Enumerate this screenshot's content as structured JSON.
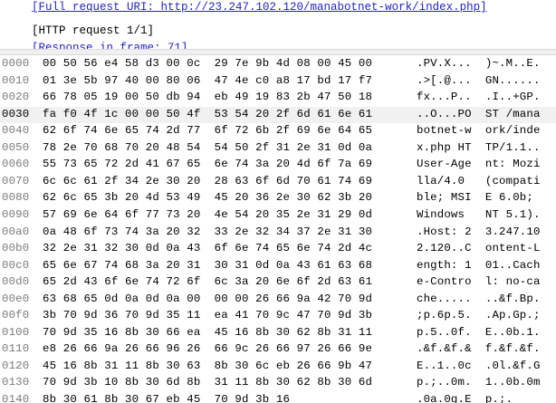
{
  "detail": {
    "lines": [
      {
        "text": "[Full request URI: http://23.247.102.120/manabotnet-work/index.php]",
        "link": true
      },
      {
        "text": "[HTTP request 1/1]",
        "link": false
      },
      {
        "text": "[Response in frame: 71]",
        "link": true
      }
    ]
  },
  "hexdump": {
    "selected_row": 3,
    "rows": [
      {
        "offset": "0000",
        "hex": "00 50 56 e4 58 d3 00 0c  29 7e 9b 4d 08 00 45 00",
        "ascii": ".PV.X...  )~.M..E."
      },
      {
        "offset": "0010",
        "hex": "01 3e 5b 97 40 00 80 06  47 4e c0 a8 17 bd 17 f7",
        "ascii": ".>[.@...  GN......"
      },
      {
        "offset": "0020",
        "hex": "66 78 05 19 00 50 db 94  eb 49 19 83 2b 47 50 18",
        "ascii": "fx...P..  .I..+GP."
      },
      {
        "offset": "0030",
        "hex": "fa f0 4f 1c 00 00 50 4f  53 54 20 2f 6d 61 6e 61",
        "ascii": "..O...PO  ST /mana"
      },
      {
        "offset": "0040",
        "hex": "62 6f 74 6e 65 74 2d 77  6f 72 6b 2f 69 6e 64 65",
        "ascii": "botnet-w  ork/inde"
      },
      {
        "offset": "0050",
        "hex": "78 2e 70 68 70 20 48 54  54 50 2f 31 2e 31 0d 0a",
        "ascii": "x.php HT  TP/1.1.."
      },
      {
        "offset": "0060",
        "hex": "55 73 65 72 2d 41 67 65  6e 74 3a 20 4d 6f 7a 69",
        "ascii": "User-Age  nt: Mozi"
      },
      {
        "offset": "0070",
        "hex": "6c 6c 61 2f 34 2e 30 20  28 63 6f 6d 70 61 74 69",
        "ascii": "lla/4.0   (compati"
      },
      {
        "offset": "0080",
        "hex": "62 6c 65 3b 20 4d 53 49  45 20 36 2e 30 62 3b 20",
        "ascii": "ble; MSI  E 6.0b; "
      },
      {
        "offset": "0090",
        "hex": "57 69 6e 64 6f 77 73 20  4e 54 20 35 2e 31 29 0d",
        "ascii": "Windows   NT 5.1)."
      },
      {
        "offset": "00a0",
        "hex": "0a 48 6f 73 74 3a 20 32  33 2e 32 34 37 2e 31 30",
        "ascii": ".Host: 2  3.247.10"
      },
      {
        "offset": "00b0",
        "hex": "32 2e 31 32 30 0d 0a 43  6f 6e 74 65 6e 74 2d 4c",
        "ascii": "2.120..C  ontent-L"
      },
      {
        "offset": "00c0",
        "hex": "65 6e 67 74 68 3a 20 31  30 31 0d 0a 43 61 63 68",
        "ascii": "ength: 1  01..Cach"
      },
      {
        "offset": "00d0",
        "hex": "65 2d 43 6f 6e 74 72 6f  6c 3a 20 6e 6f 2d 63 61",
        "ascii": "e-Contro  l: no-ca"
      },
      {
        "offset": "00e0",
        "hex": "63 68 65 0d 0a 0d 0a 00  00 00 26 66 9a 42 70 9d",
        "ascii": "che.....  ..&f.Bp."
      },
      {
        "offset": "00f0",
        "hex": "3b 70 9d 36 70 9d 35 11  ea 41 70 9c 47 70 9d 3b",
        "ascii": ";p.6p.5.  .Ap.Gp.;"
      },
      {
        "offset": "0100",
        "hex": "70 9d 35 16 8b 30 66 ea  45 16 8b 30 62 8b 31 11",
        "ascii": "p.5..0f.  E..0b.1."
      },
      {
        "offset": "0110",
        "hex": "e8 26 66 9a 26 66 96 26  66 9c 26 66 97 26 66 9e",
        "ascii": ".&f.&f.&  f.&f.&f."
      },
      {
        "offset": "0120",
        "hex": "45 16 8b 31 11 8b 30 63  8b 30 6c eb 26 66 9b 47",
        "ascii": "E..1..0c  .0l.&f.G"
      },
      {
        "offset": "0130",
        "hex": "70 9d 3b 10 8b 30 6d 8b  31 11 8b 30 62 8b 30 6d",
        "ascii": "p.;..0m.  1..0b.0m"
      },
      {
        "offset": "0140",
        "hex": "8b 30 61 8b 30 67 eb 45  70 9d 3b 16",
        "ascii": ".0a.0g.E  p.;."
      }
    ]
  }
}
